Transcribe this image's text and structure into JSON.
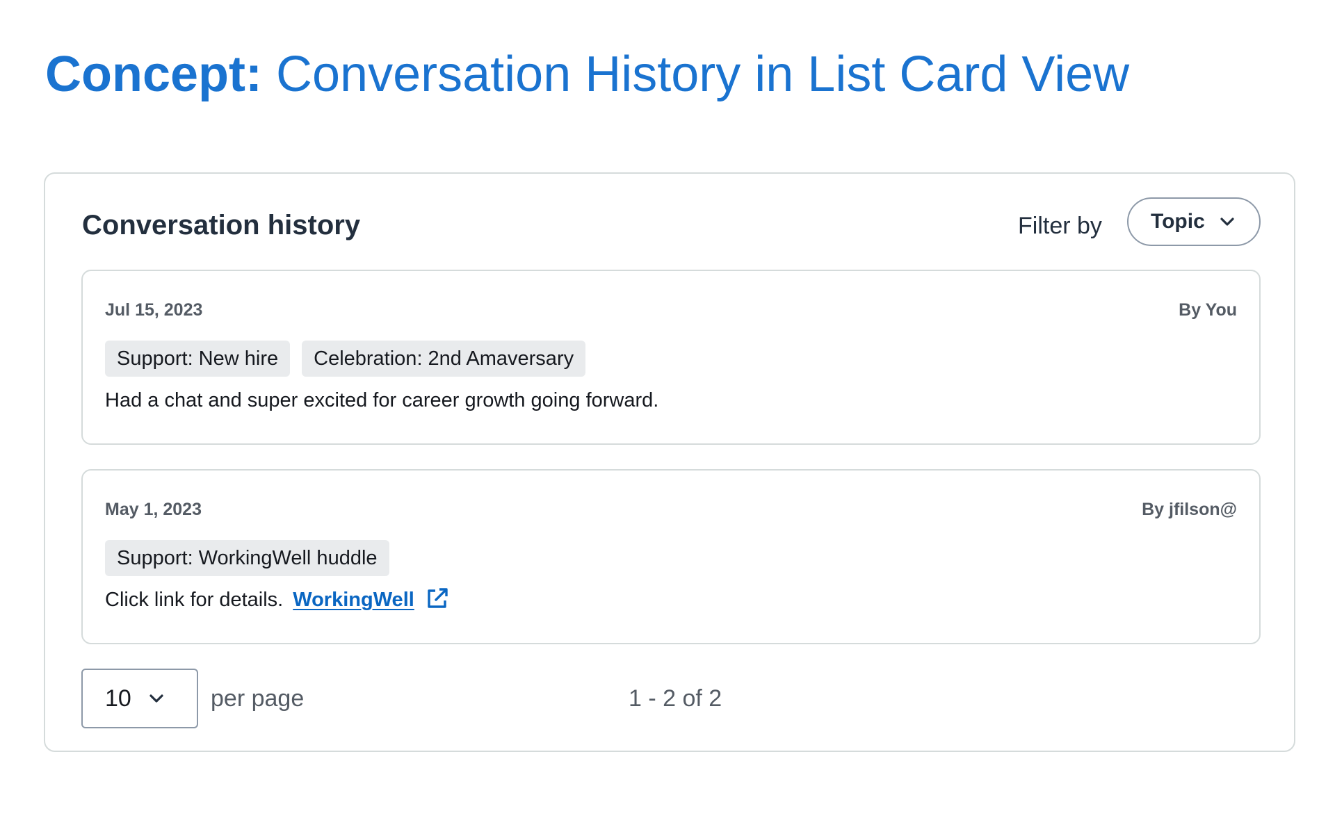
{
  "title": {
    "prefix": "Concept:",
    "text": "Conversation History in List Card View"
  },
  "panel": {
    "heading": "Conversation history",
    "filter": {
      "label": "Filter by",
      "selected": "Topic",
      "icon": "chevron-down-icon"
    },
    "cards": [
      {
        "date": "Jul 15, 2023",
        "author": "By You",
        "tags": [
          "Support: New hire",
          "Celebration: 2nd Amaversary"
        ],
        "text": "Had a chat and super excited for career growth going forward."
      },
      {
        "date": "May 1, 2023",
        "author": "By jfilson@",
        "tags": [
          "Support: WorkingWell huddle"
        ],
        "text": "Click link for details.",
        "link_text": "WorkingWell",
        "link_icon": "external-link-icon"
      }
    ],
    "pagination": {
      "per_page_value": "10",
      "per_page_label": "per page",
      "range": "1 - 2 of 2"
    }
  },
  "colors": {
    "accent": "#1a73d0",
    "link": "#0a66c2",
    "tag_bg": "#e9ebed",
    "border": "#d5dbdb"
  }
}
